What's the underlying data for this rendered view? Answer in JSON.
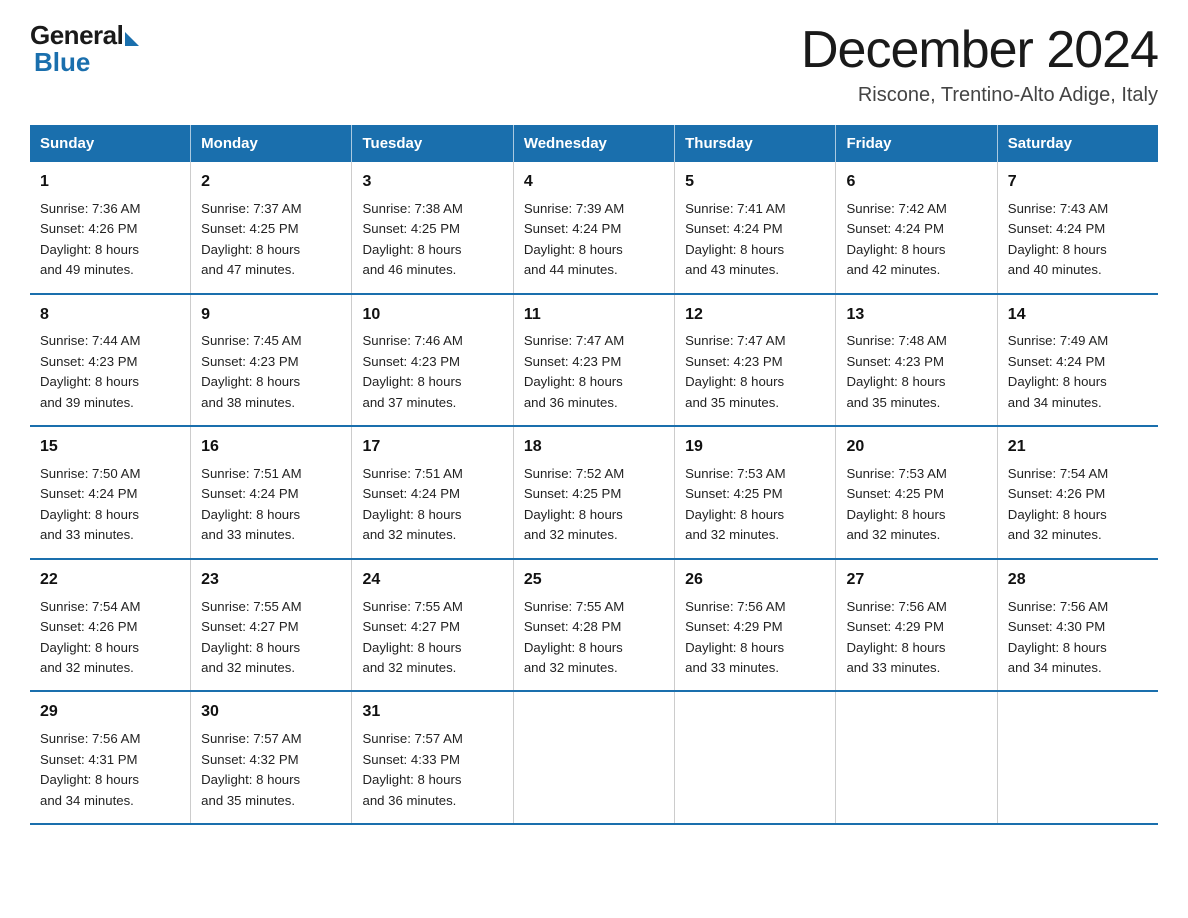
{
  "header": {
    "logo_general": "General",
    "logo_blue": "Blue",
    "title": "December 2024",
    "subtitle": "Riscone, Trentino-Alto Adige, Italy"
  },
  "days_of_week": [
    "Sunday",
    "Monday",
    "Tuesday",
    "Wednesday",
    "Thursday",
    "Friday",
    "Saturday"
  ],
  "weeks": [
    [
      {
        "day": "1",
        "sunrise": "7:36 AM",
        "sunset": "4:26 PM",
        "daylight": "8 hours and 49 minutes."
      },
      {
        "day": "2",
        "sunrise": "7:37 AM",
        "sunset": "4:25 PM",
        "daylight": "8 hours and 47 minutes."
      },
      {
        "day": "3",
        "sunrise": "7:38 AM",
        "sunset": "4:25 PM",
        "daylight": "8 hours and 46 minutes."
      },
      {
        "day": "4",
        "sunrise": "7:39 AM",
        "sunset": "4:24 PM",
        "daylight": "8 hours and 44 minutes."
      },
      {
        "day": "5",
        "sunrise": "7:41 AM",
        "sunset": "4:24 PM",
        "daylight": "8 hours and 43 minutes."
      },
      {
        "day": "6",
        "sunrise": "7:42 AM",
        "sunset": "4:24 PM",
        "daylight": "8 hours and 42 minutes."
      },
      {
        "day": "7",
        "sunrise": "7:43 AM",
        "sunset": "4:24 PM",
        "daylight": "8 hours and 40 minutes."
      }
    ],
    [
      {
        "day": "8",
        "sunrise": "7:44 AM",
        "sunset": "4:23 PM",
        "daylight": "8 hours and 39 minutes."
      },
      {
        "day": "9",
        "sunrise": "7:45 AM",
        "sunset": "4:23 PM",
        "daylight": "8 hours and 38 minutes."
      },
      {
        "day": "10",
        "sunrise": "7:46 AM",
        "sunset": "4:23 PM",
        "daylight": "8 hours and 37 minutes."
      },
      {
        "day": "11",
        "sunrise": "7:47 AM",
        "sunset": "4:23 PM",
        "daylight": "8 hours and 36 minutes."
      },
      {
        "day": "12",
        "sunrise": "7:47 AM",
        "sunset": "4:23 PM",
        "daylight": "8 hours and 35 minutes."
      },
      {
        "day": "13",
        "sunrise": "7:48 AM",
        "sunset": "4:23 PM",
        "daylight": "8 hours and 35 minutes."
      },
      {
        "day": "14",
        "sunrise": "7:49 AM",
        "sunset": "4:24 PM",
        "daylight": "8 hours and 34 minutes."
      }
    ],
    [
      {
        "day": "15",
        "sunrise": "7:50 AM",
        "sunset": "4:24 PM",
        "daylight": "8 hours and 33 minutes."
      },
      {
        "day": "16",
        "sunrise": "7:51 AM",
        "sunset": "4:24 PM",
        "daylight": "8 hours and 33 minutes."
      },
      {
        "day": "17",
        "sunrise": "7:51 AM",
        "sunset": "4:24 PM",
        "daylight": "8 hours and 32 minutes."
      },
      {
        "day": "18",
        "sunrise": "7:52 AM",
        "sunset": "4:25 PM",
        "daylight": "8 hours and 32 minutes."
      },
      {
        "day": "19",
        "sunrise": "7:53 AM",
        "sunset": "4:25 PM",
        "daylight": "8 hours and 32 minutes."
      },
      {
        "day": "20",
        "sunrise": "7:53 AM",
        "sunset": "4:25 PM",
        "daylight": "8 hours and 32 minutes."
      },
      {
        "day": "21",
        "sunrise": "7:54 AM",
        "sunset": "4:26 PM",
        "daylight": "8 hours and 32 minutes."
      }
    ],
    [
      {
        "day": "22",
        "sunrise": "7:54 AM",
        "sunset": "4:26 PM",
        "daylight": "8 hours and 32 minutes."
      },
      {
        "day": "23",
        "sunrise": "7:55 AM",
        "sunset": "4:27 PM",
        "daylight": "8 hours and 32 minutes."
      },
      {
        "day": "24",
        "sunrise": "7:55 AM",
        "sunset": "4:27 PM",
        "daylight": "8 hours and 32 minutes."
      },
      {
        "day": "25",
        "sunrise": "7:55 AM",
        "sunset": "4:28 PM",
        "daylight": "8 hours and 32 minutes."
      },
      {
        "day": "26",
        "sunrise": "7:56 AM",
        "sunset": "4:29 PM",
        "daylight": "8 hours and 33 minutes."
      },
      {
        "day": "27",
        "sunrise": "7:56 AM",
        "sunset": "4:29 PM",
        "daylight": "8 hours and 33 minutes."
      },
      {
        "day": "28",
        "sunrise": "7:56 AM",
        "sunset": "4:30 PM",
        "daylight": "8 hours and 34 minutes."
      }
    ],
    [
      {
        "day": "29",
        "sunrise": "7:56 AM",
        "sunset": "4:31 PM",
        "daylight": "8 hours and 34 minutes."
      },
      {
        "day": "30",
        "sunrise": "7:57 AM",
        "sunset": "4:32 PM",
        "daylight": "8 hours and 35 minutes."
      },
      {
        "day": "31",
        "sunrise": "7:57 AM",
        "sunset": "4:33 PM",
        "daylight": "8 hours and 36 minutes."
      },
      null,
      null,
      null,
      null
    ]
  ],
  "labels": {
    "sunrise": "Sunrise:",
    "sunset": "Sunset:",
    "daylight": "Daylight:"
  }
}
